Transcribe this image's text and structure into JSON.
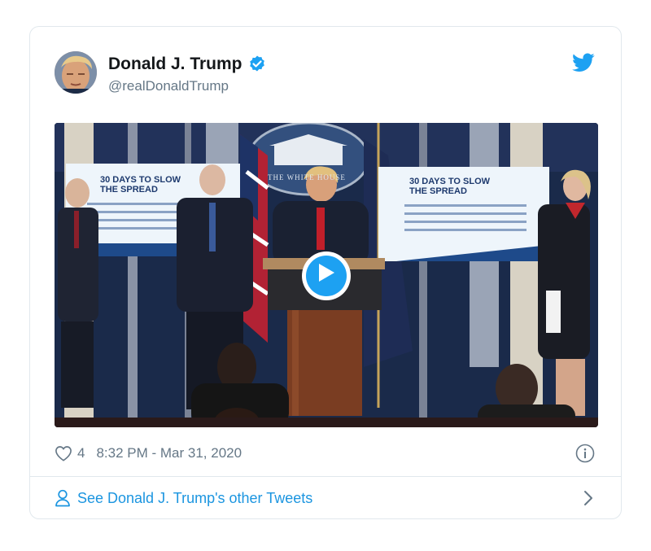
{
  "tweet": {
    "display_name": "Donald J. Trump",
    "handle": "@realDonaldTrump",
    "verified_icon": "verified-badge-icon",
    "platform_icon": "twitter-bird-icon",
    "like_count": "4",
    "timestamp": "8:32 PM - Mar 31, 2020",
    "see_more_label": "See Donald J. Trump's other Tweets"
  },
  "media": {
    "type": "video",
    "play_icon": "play-icon",
    "slide_left_title": "30 DAYS TO SLOW\nTHE SPREAD",
    "slide_right_title": "30 DAYS TO SLOW\nTHE SPREAD",
    "seal_text": "THE WHITE HOUSE"
  },
  "colors": {
    "brand_blue": "#1da1f2",
    "link_blue": "#1b95e0",
    "muted_text": "#657786",
    "border": "#e1e8ed"
  }
}
